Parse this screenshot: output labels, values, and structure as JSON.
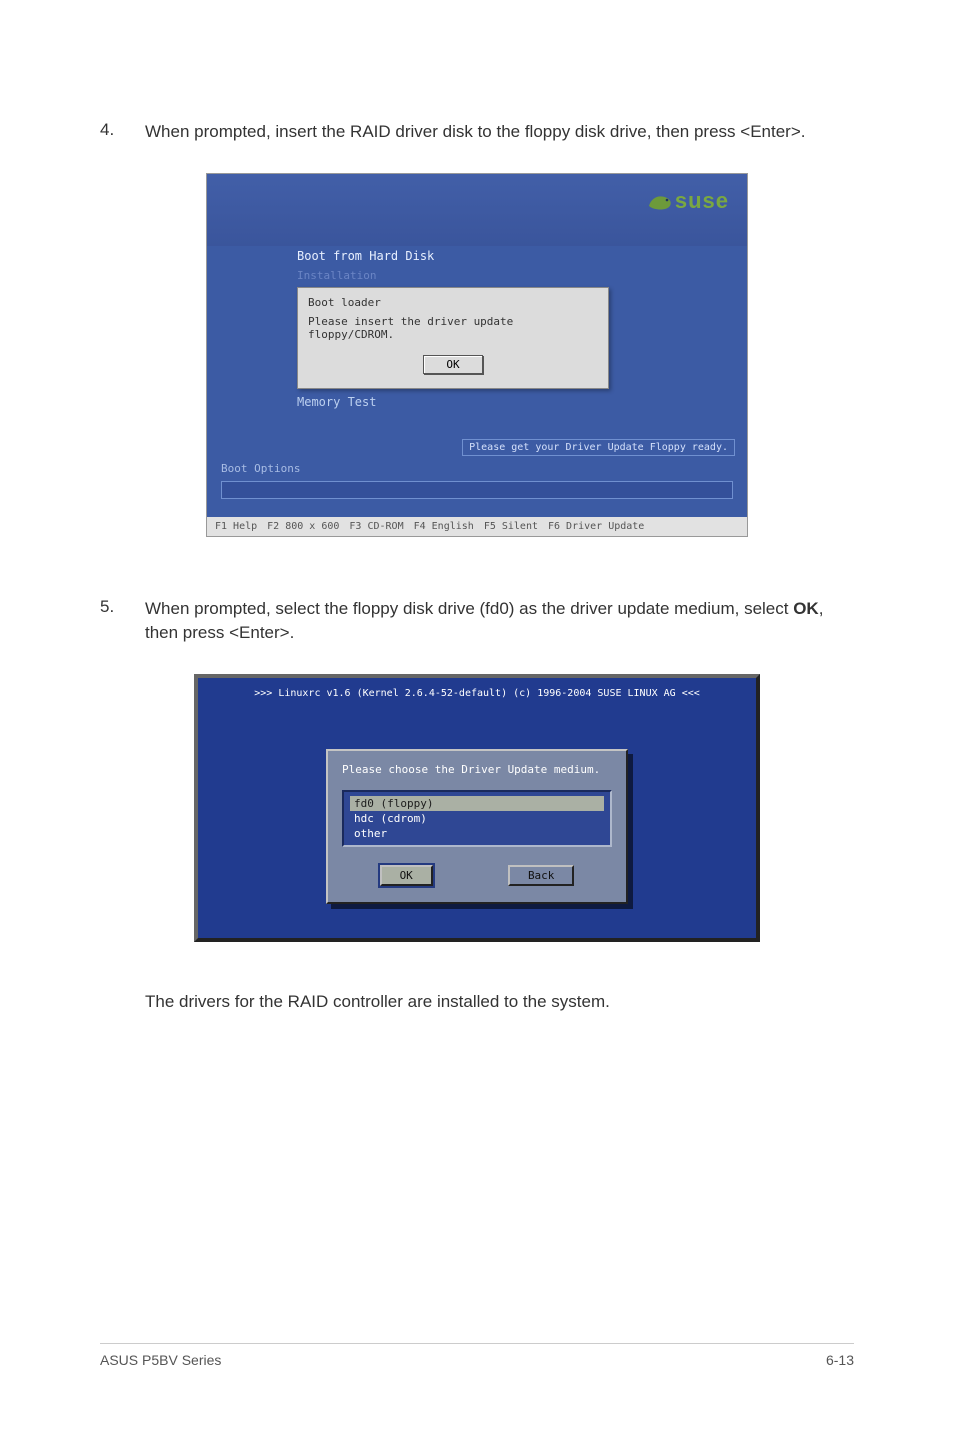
{
  "step4": {
    "num": "4.",
    "text_a": "When prompted, insert the RAID driver disk to the floppy disk drive, then press <Enter>."
  },
  "suse": {
    "logo_text": "suse",
    "menu_boot_hd": "Boot from Hard Disk",
    "menu_install_fade": "Installation",
    "dialog_title": "Boot loader",
    "dialog_msg": "Please insert the driver update floppy/CDROM.",
    "dialog_ok": "OK",
    "menu_memtest": "Memory Test",
    "hint": "Please get your Driver Update Floppy ready.",
    "boot_options_label": "Boot Options",
    "fkeys": {
      "f1": "F1 Help",
      "f2": "F2 800 x 600",
      "f3": "F3 CD-ROM",
      "f4": "F4 English",
      "f5": "F5 Silent",
      "f6": "F6 Driver Update"
    }
  },
  "step5": {
    "num": "5.",
    "text_a": "When prompted, select the floppy disk drive (fd0) as the driver update medium, select ",
    "ok": "OK",
    "text_b": ", then press <Enter>."
  },
  "linuxrc": {
    "title": ">>> Linuxrc v1.6 (Kernel 2.6.4-52-default) (c) 1996-2004 SUSE LINUX AG <<<",
    "msg": "Please choose the Driver Update medium.",
    "items": {
      "a": "fd0 (floppy)",
      "b": "hdc (cdrom)",
      "c": "other"
    },
    "ok": "OK",
    "back": "Back"
  },
  "closing": "The drivers for the RAID controller are installed to the system.",
  "footer": {
    "left": "ASUS P5BV Series",
    "right": "6-13"
  }
}
